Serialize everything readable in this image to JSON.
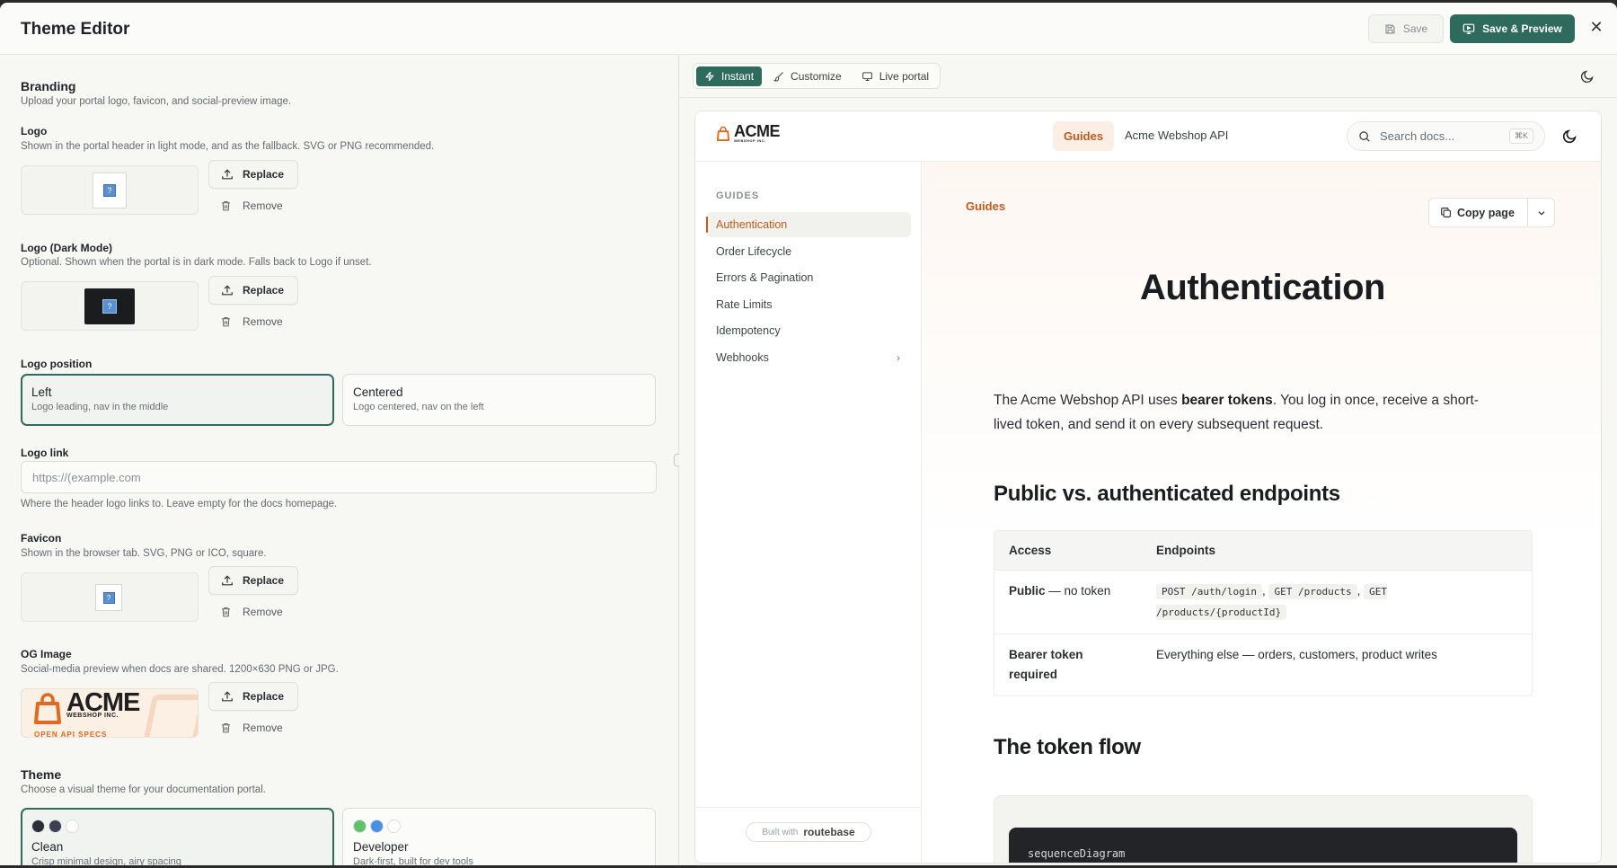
{
  "app": {
    "title": "Theme Editor",
    "save_label": "Save",
    "save_preview_label": "Save & Preview",
    "close_glyph": "✕"
  },
  "branding": {
    "title": "Branding",
    "description": "Upload your portal logo, favicon, and social-preview image.",
    "replace_label": "Replace",
    "remove_label": "Remove",
    "logo": {
      "label": "Logo",
      "description": "Shown in the portal header in light mode, and as the fallback. SVG or PNG recommended."
    },
    "logo_dark": {
      "label": "Logo (Dark Mode)",
      "description": "Optional. Shown when the portal is in dark mode. Falls back to Logo if unset."
    },
    "logo_position": {
      "label": "Logo position",
      "options": [
        {
          "title": "Left",
          "subtitle": "Logo leading, nav in the middle",
          "selected": true
        },
        {
          "title": "Centered",
          "subtitle": "Logo centered, nav on the left",
          "selected": false
        }
      ]
    },
    "logo_link": {
      "label": "Logo link",
      "placeholder": "https://(example.com",
      "value": "",
      "help": "Where the header logo links to. Leave empty for the docs homepage."
    },
    "favicon": {
      "label": "Favicon",
      "description": "Shown in the browser tab. SVG, PNG or ICO, square."
    },
    "og_image": {
      "label": "OG Image",
      "description": "Social-media preview when docs are shared. 1200×630 PNG or JPG.",
      "brand_text": "ACME",
      "brand_sub": "WEBSHOP INC.",
      "tagline": "OPEN API SPECS"
    }
  },
  "theme": {
    "title": "Theme",
    "description": "Choose a visual theme for your documentation portal.",
    "options": [
      {
        "title": "Clean",
        "subtitle": "Crisp minimal design, airy spacing",
        "selected": true,
        "swatches": [
          "#2b2f36",
          "#3a4150",
          "#ffffff"
        ]
      },
      {
        "title": "Developer",
        "subtitle": "Dark-first, built for dev tools",
        "selected": false,
        "swatches": [
          "#5cc36b",
          "#4a90e2",
          "#ffffff"
        ]
      }
    ]
  },
  "preview_tabs": [
    {
      "label": "Instant",
      "active": true,
      "icon": "bolt-icon"
    },
    {
      "label": "Customize",
      "active": false,
      "icon": "brush-icon"
    },
    {
      "label": "Live portal",
      "active": false,
      "icon": "monitor-icon"
    }
  ],
  "portal": {
    "logo_text": "ACME",
    "logo_sub": "WEBSHOP INC.",
    "nav": [
      {
        "label": "Guides",
        "active": true
      },
      {
        "label": "Acme Webshop API",
        "active": false
      }
    ],
    "search_placeholder": "Search docs...",
    "search_shortcut": "⌘K",
    "sidebar_caption": "GUIDES",
    "sidebar_items": [
      {
        "label": "Authentication",
        "active": true
      },
      {
        "label": "Order Lifecycle",
        "active": false
      },
      {
        "label": "Errors & Pagination",
        "active": false
      },
      {
        "label": "Rate Limits",
        "active": false
      },
      {
        "label": "Idempotency",
        "active": false
      },
      {
        "label": "Webhooks",
        "active": false,
        "has_children": true
      }
    ],
    "built_with_prefix": "Built with",
    "built_with_brand": "routebase",
    "breadcrumb": "Guides",
    "copy_page_label": "Copy page",
    "page_title": "Authentication",
    "lead_1": "The Acme Webshop API uses ",
    "lead_bold": "bearer tokens",
    "lead_2": ". You log in once, receive a short-lived token, and send it on every subsequent request.",
    "h2_public": "Public vs. authenticated endpoints",
    "table": {
      "headers": [
        "Access",
        "Endpoints"
      ],
      "row1_access_bold": "Public",
      "row1_access_rest": " — no token",
      "row1_codes": [
        "POST /auth/login",
        "GET /products",
        "GET /products/{productId}"
      ],
      "row2_access": "Bearer token required",
      "row2_endpoints": "Everything else — orders, customers, product writes"
    },
    "h2_flow": "The token flow",
    "code_first_line": "sequenceDiagram"
  },
  "colors": {
    "accent": "#2f6b5c",
    "portal_accent": "#c25a1c"
  }
}
